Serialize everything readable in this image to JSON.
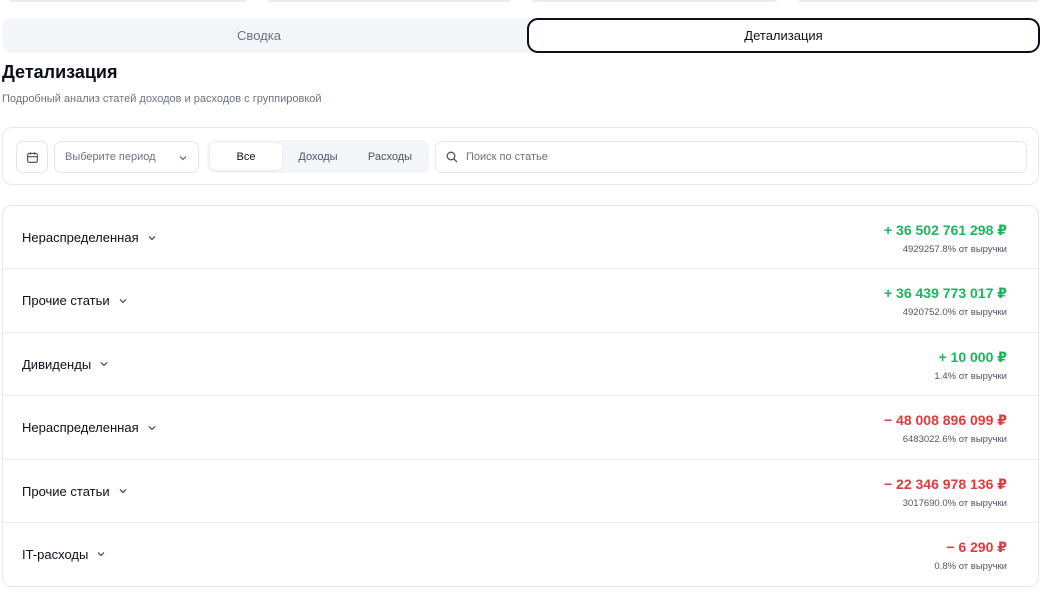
{
  "tabs": [
    {
      "label": "Сводка",
      "active": false
    },
    {
      "label": "Детализация",
      "active": true
    }
  ],
  "page": {
    "title": "Детализация",
    "subtitle": "Подробный анализ статей доходов и расходов с группировкой"
  },
  "filters": {
    "calendar_icon": "calendar-icon",
    "period_placeholder": "Выберите период",
    "type_options": [
      "Все",
      "Доходы",
      "Расходы"
    ],
    "type_selected": "Все",
    "search_placeholder": "Поиск по статье"
  },
  "colors": {
    "income": "#1bb55c",
    "expense": "#e03a3a",
    "accent_border": "#0b0f19"
  },
  "rows": [
    {
      "name": "Нераспределенная",
      "amount": "+ 36 502 761 298 ₽",
      "share": "4929257.8% от выручки",
      "kind": "income"
    },
    {
      "name": "Прочие статьи",
      "amount": "+ 36 439 773 017 ₽",
      "share": "4920752.0% от выручки",
      "kind": "income"
    },
    {
      "name": "Дивиденды",
      "amount": "+ 10 000 ₽",
      "share": "1.4% от выручки",
      "kind": "income"
    },
    {
      "name": "Нераспределенная",
      "amount": "− 48 008 896 099 ₽",
      "share": "6483022.6% от выручки",
      "kind": "expense"
    },
    {
      "name": "Прочие статьи",
      "amount": "− 22 346 978 136 ₽",
      "share": "3017690.0% от выручки",
      "kind": "expense"
    },
    {
      "name": "IT-расходы",
      "amount": "− 6 290 ₽",
      "share": "0.8% от выручки",
      "kind": "expense"
    }
  ]
}
